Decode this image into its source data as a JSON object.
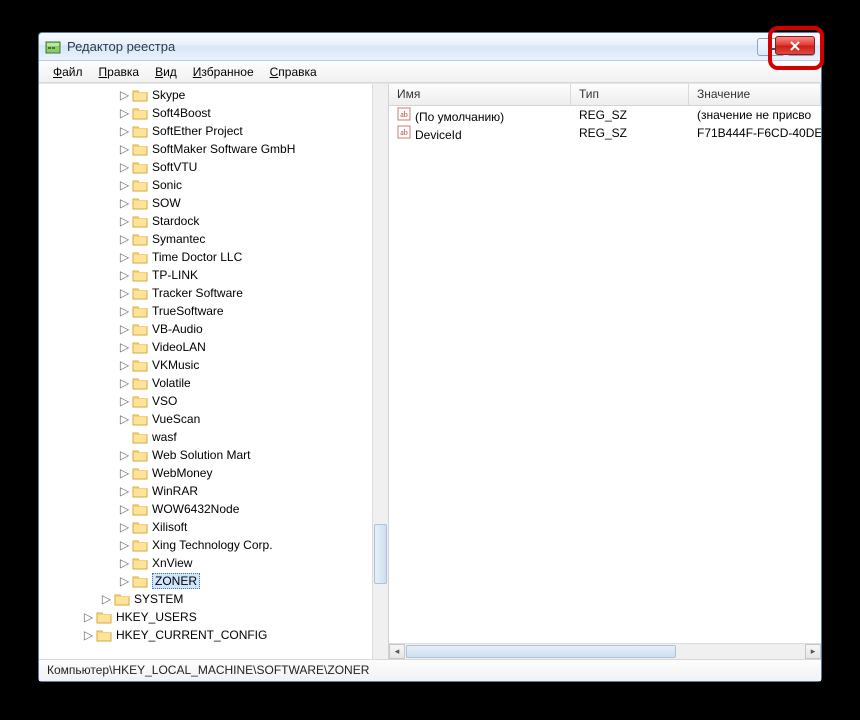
{
  "window": {
    "title": "Редактор реестра"
  },
  "menu": {
    "file": "Файл",
    "edit": "Правка",
    "view": "Вид",
    "favorites": "Избранное",
    "help": "Справка"
  },
  "tree": {
    "items": [
      {
        "indent": 4,
        "expander": "▷",
        "label": "Skype"
      },
      {
        "indent": 4,
        "expander": "▷",
        "label": "Soft4Boost"
      },
      {
        "indent": 4,
        "expander": "▷",
        "label": "SoftEther Project"
      },
      {
        "indent": 4,
        "expander": "▷",
        "label": "SoftMaker Software GmbH"
      },
      {
        "indent": 4,
        "expander": "▷",
        "label": "SoftVTU"
      },
      {
        "indent": 4,
        "expander": "▷",
        "label": "Sonic"
      },
      {
        "indent": 4,
        "expander": "▷",
        "label": "SOW"
      },
      {
        "indent": 4,
        "expander": "▷",
        "label": "Stardock"
      },
      {
        "indent": 4,
        "expander": "▷",
        "label": "Symantec"
      },
      {
        "indent": 4,
        "expander": "▷",
        "label": "Time Doctor LLC"
      },
      {
        "indent": 4,
        "expander": "▷",
        "label": "TP-LINK"
      },
      {
        "indent": 4,
        "expander": "▷",
        "label": "Tracker Software"
      },
      {
        "indent": 4,
        "expander": "▷",
        "label": "TrueSoftware"
      },
      {
        "indent": 4,
        "expander": "▷",
        "label": "VB-Audio"
      },
      {
        "indent": 4,
        "expander": "▷",
        "label": "VideoLAN"
      },
      {
        "indent": 4,
        "expander": "▷",
        "label": "VKMusic"
      },
      {
        "indent": 4,
        "expander": "▷",
        "label": "Volatile"
      },
      {
        "indent": 4,
        "expander": "▷",
        "label": "VSO"
      },
      {
        "indent": 4,
        "expander": "▷",
        "label": "VueScan"
      },
      {
        "indent": 4,
        "expander": "",
        "label": "wasf"
      },
      {
        "indent": 4,
        "expander": "▷",
        "label": "Web Solution Mart"
      },
      {
        "indent": 4,
        "expander": "▷",
        "label": "WebMoney"
      },
      {
        "indent": 4,
        "expander": "▷",
        "label": "WinRAR"
      },
      {
        "indent": 4,
        "expander": "▷",
        "label": "WOW6432Node"
      },
      {
        "indent": 4,
        "expander": "▷",
        "label": "Xilisoft"
      },
      {
        "indent": 4,
        "expander": "▷",
        "label": "Xing Technology Corp."
      },
      {
        "indent": 4,
        "expander": "▷",
        "label": "XnView"
      },
      {
        "indent": 4,
        "expander": "▷",
        "label": "ZONER",
        "selected": true
      },
      {
        "indent": 3,
        "expander": "▷",
        "label": "SYSTEM"
      },
      {
        "indent": 2,
        "expander": "▷",
        "label": "HKEY_USERS"
      },
      {
        "indent": 2,
        "expander": "▷",
        "label": "HKEY_CURRENT_CONFIG"
      }
    ]
  },
  "list": {
    "columns": {
      "name": "Имя",
      "type": "Тип",
      "value": "Значение"
    },
    "rows": [
      {
        "name": "(По умолчанию)",
        "type": "REG_SZ",
        "value": "(значение не присво"
      },
      {
        "name": "DeviceId",
        "type": "REG_SZ",
        "value": "F71B444F-F6CD-40DE"
      }
    ]
  },
  "statusbar": {
    "path": "Компьютер\\HKEY_LOCAL_MACHINE\\SOFTWARE\\ZONER"
  }
}
